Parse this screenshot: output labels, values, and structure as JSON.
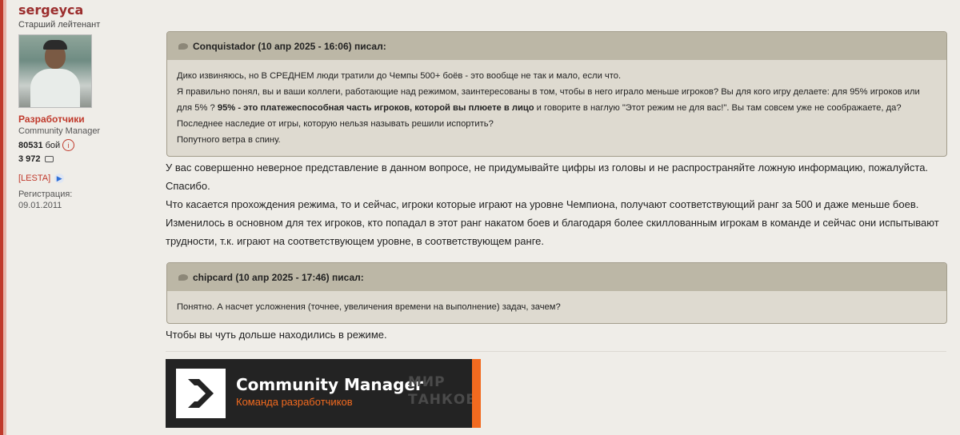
{
  "author": {
    "username": "sergeyca",
    "rank": "Старший лейтенант",
    "role": "Разработчики",
    "subrole": "Community Manager",
    "battles_count": "80531",
    "battles_label": "бой",
    "posts_count": "3 972",
    "clan_tag": "[LESTA]",
    "registration_label": "Регистрация:",
    "registration_date": "09.01.2011"
  },
  "quote1": {
    "header": "Conquistador (10 апр 2025 - 16:06) писал:",
    "line1": "Дико извиняюсь, но В СРЕДНЕМ люди тратили  до Чемпы 500+ боёв - это вообще не так и мало, если что.",
    "line2a": "Я правильно понял, вы и ваши коллеги, работающие над режимом, заинтересованы в том, чтобы в него играло меньше игроков? Вы для кого игру делаете: для 95% игроков или для 5% ? ",
    "line2b": "95% - это платежеспособная часть игроков, которой вы плюете в лицо",
    "line2c": " и говорите в наглую \"Этот режим не для вас!\". Вы там совсем уже не соображаете, да? Последнее наследие от игры, которую нельзя называть решили испортить?",
    "line3": "Попутного ветра  в спину."
  },
  "reply1": {
    "p1": "У вас совершенно неверное представление в данном вопросе, не придумывайте цифры из головы и не распространяйте ложную информацию, пожалуйста. Спасибо.",
    "p2": "Что касается прохождения режима, то и сейчас, игроки которые играют на уровне Чемпиона, получают соответствующий ранг за 500 и даже меньше боев. Изменилось в основном для тех игроков, кто попадал в этот ранг накатом боев и благодаря более скиллованным игрокам в команде и сейчас они испытывают трудности, т.к. играют на соответствующем уровне, в соответствующем ранге."
  },
  "quote2": {
    "header": "chipcard (10 апр 2025 - 17:46) писал:",
    "text": "Понятно. А насчет усложнения (точнее, увеличения времени на выполнение) задач, зачем?"
  },
  "reply2": {
    "text": "Чтобы вы чуть дольше находились в режиме."
  },
  "banner": {
    "title": "Community Manager",
    "subtitle": "Команда разработчиков",
    "brand_line1": "МИР",
    "brand_line2": "ТАНКОВ",
    "accent_color": "#f26a1f"
  }
}
